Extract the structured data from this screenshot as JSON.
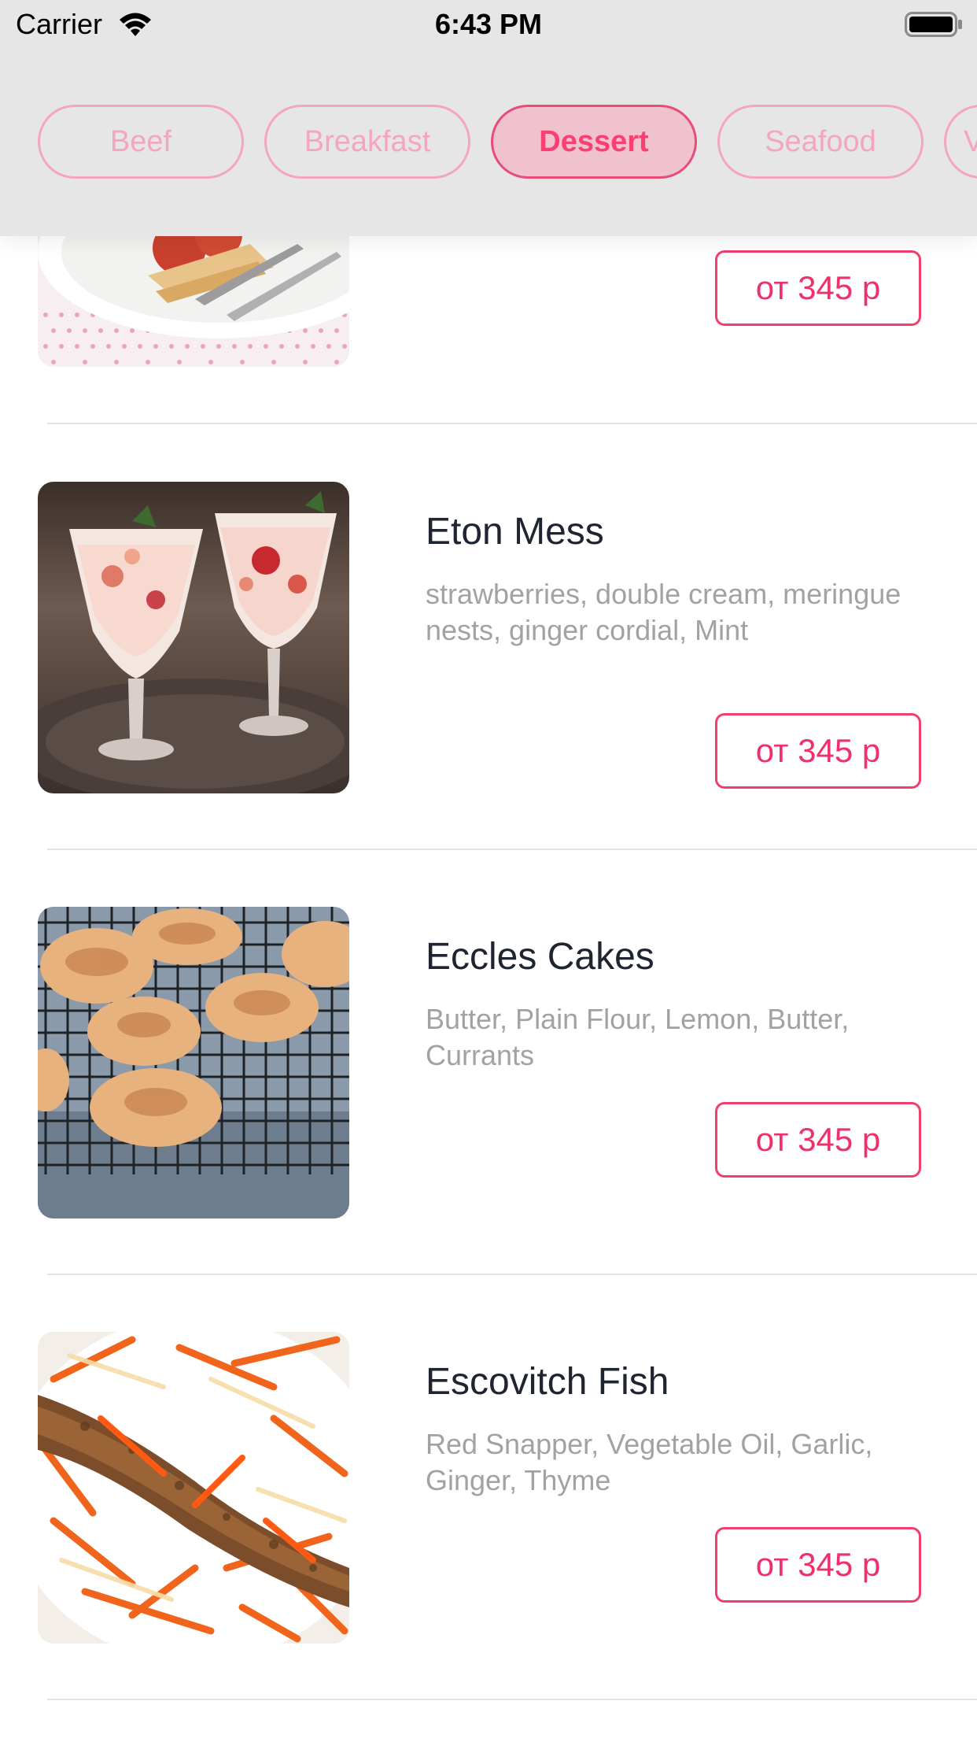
{
  "status_bar": {
    "carrier": "Carrier",
    "time": "6:43 PM",
    "wifi_icon": "wifi-icon",
    "battery_icon": "battery-icon"
  },
  "categories": {
    "items": [
      {
        "label": "Beef",
        "active": false
      },
      {
        "label": "Breakfast",
        "active": false
      },
      {
        "label": "Dessert",
        "active": true
      },
      {
        "label": "Seafood",
        "active": false
      },
      {
        "label": "V",
        "active": false
      }
    ]
  },
  "colors": {
    "accent": "#f0306a",
    "chip_border": "#f3a6bd",
    "chip_active_bg": "#efc2ce",
    "header_bg": "#e6e6e6",
    "title_text": "#1f2530",
    "ingredients_text": "#a2a2a2",
    "divider": "#e2e2e2"
  },
  "menu": {
    "items": [
      {
        "name": "",
        "ingredients": "",
        "price": "от 345 р",
        "image": "breakfast-plate-photo"
      },
      {
        "name": "Eton Mess",
        "ingredients": "strawberries, double cream, meringue nests, ginger cordial, Mint",
        "price": "от 345 р",
        "image": "eton-mess-photo"
      },
      {
        "name": "Eccles Cakes",
        "ingredients": "Butter, Plain Flour, Lemon, Butter, Currants",
        "price": "от 345 р",
        "image": "eccles-cakes-photo"
      },
      {
        "name": "Escovitch Fish",
        "ingredients": "Red Snapper, Vegetable Oil, Garlic, Ginger, Thyme",
        "price": "от 345 р",
        "image": "escovitch-fish-photo"
      }
    ]
  }
}
